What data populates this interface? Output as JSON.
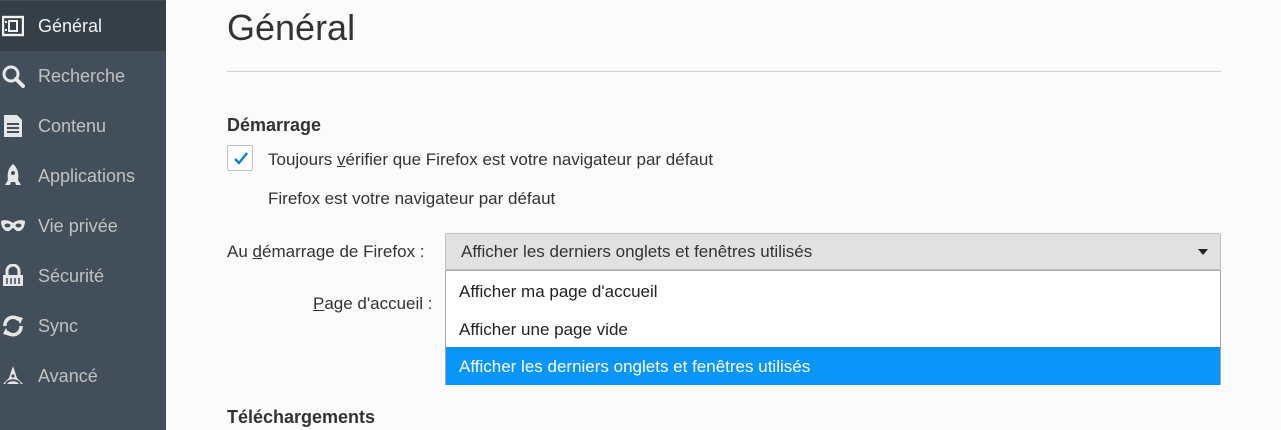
{
  "sidebar": {
    "items": [
      {
        "label": "Général",
        "icon": "general-icon",
        "selected": true
      },
      {
        "label": "Recherche",
        "icon": "search-icon",
        "selected": false
      },
      {
        "label": "Contenu",
        "icon": "content-icon",
        "selected": false
      },
      {
        "label": "Applications",
        "icon": "applications-icon",
        "selected": false
      },
      {
        "label": "Vie privée",
        "icon": "privacy-mask-icon",
        "selected": false
      },
      {
        "label": "Sécurité",
        "icon": "security-icon",
        "selected": false
      },
      {
        "label": "Sync",
        "icon": "sync-icon",
        "selected": false
      },
      {
        "label": "Avancé",
        "icon": "advanced-icon",
        "selected": false
      }
    ]
  },
  "main": {
    "title": "Général",
    "startup": {
      "heading": "Démarrage",
      "default_check": {
        "label_pre": "Toujours ",
        "label_access": "v",
        "label_post": "érifier que Firefox est votre navigateur par défaut",
        "checked": true
      },
      "default_status": "Firefox est votre navigateur par défaut",
      "on_start": {
        "label_pre": "Au ",
        "label_access": "d",
        "label_post": "émarrage de Firefox :",
        "selected_value": "Afficher les derniers onglets et fenêtres utilisés",
        "options": [
          {
            "label": "Afficher ma page d'accueil",
            "highlighted": false
          },
          {
            "label": "Afficher une page vide",
            "highlighted": false
          },
          {
            "label": "Afficher les derniers onglets et fenêtres utilisés",
            "highlighted": true
          }
        ]
      },
      "homepage": {
        "label_access": "P",
        "label_post": "age d'accueil :"
      }
    },
    "downloads": {
      "heading": "Téléchargements"
    }
  },
  "colors": {
    "sidebar_bg": "#424f5a",
    "sidebar_selected_bg": "#343f48",
    "accent": "#0996f8",
    "check": "#0a84c1"
  }
}
